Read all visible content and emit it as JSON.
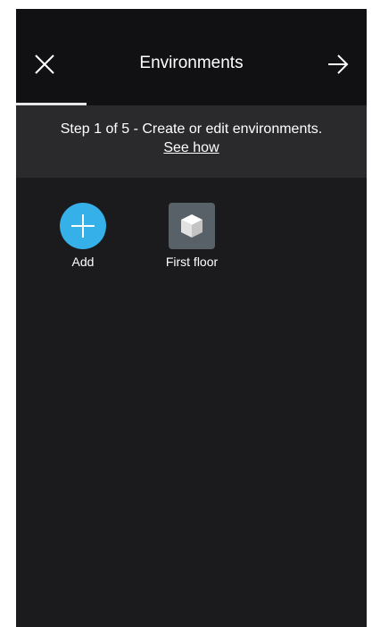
{
  "header": {
    "title": "Environments",
    "close_icon": "close-icon",
    "next_icon": "arrow-right-icon"
  },
  "progress": {
    "current_step": 1,
    "total_steps": 5,
    "fraction": 0.2
  },
  "banner": {
    "step_text": "Step 1 of 5 - Create or edit environments.",
    "link_text": "See how"
  },
  "environments": {
    "add": {
      "label": "Add",
      "icon": "plus-icon"
    },
    "items": [
      {
        "label": "First floor",
        "icon": "cube-icon"
      }
    ]
  },
  "colors": {
    "background": "#1b1b1d",
    "header": "#111113",
    "banner": "#2a2a2c",
    "accent": "#35b0e9",
    "tile": "#596168",
    "text": "#ffffff"
  }
}
